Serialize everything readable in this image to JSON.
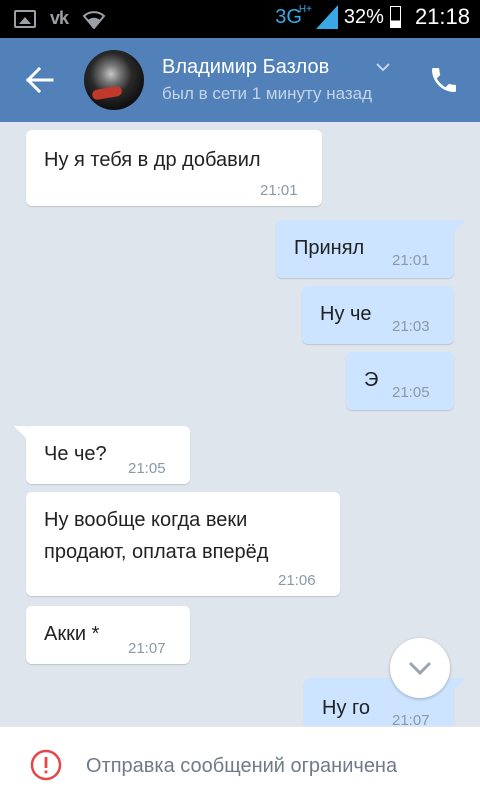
{
  "status_bar": {
    "network": "3G",
    "network_sup": "H+",
    "battery_percent": "32%",
    "battery_level": 0.32,
    "time": "21:18",
    "icons": [
      "image-icon",
      "vk-icon",
      "wifi-icon"
    ]
  },
  "header": {
    "peer_name": "Владимир Базлов",
    "peer_status": "был в сети 1 минуту назад"
  },
  "messages": [
    {
      "dir": "in",
      "text": "Ну я тебя в др добавил",
      "time": "21:01"
    },
    {
      "dir": "out",
      "text": "Принял",
      "time": "21:01"
    },
    {
      "dir": "out",
      "text": "Ну че",
      "time": "21:03"
    },
    {
      "dir": "out",
      "text": "Э",
      "time": "21:05"
    },
    {
      "dir": "in",
      "text": "Че че?",
      "time": "21:05"
    },
    {
      "dir": "in",
      "text_lines": [
        "Ну вообще когда веки",
        "продают, оплата вперёд"
      ],
      "time": "21:06"
    },
    {
      "dir": "in",
      "text": "Акки *",
      "time": "21:07"
    },
    {
      "dir": "out",
      "text": "Ну го",
      "time": "21:07"
    }
  ],
  "footer": {
    "notice": "Отправка сообщений ограничена"
  },
  "colors": {
    "header_bg": "#5181b8",
    "chat_bg": "#dfe5ec",
    "incoming_bubble": "#ffffff",
    "outgoing_bubble": "#cce4ff",
    "warning": "#e64646"
  }
}
